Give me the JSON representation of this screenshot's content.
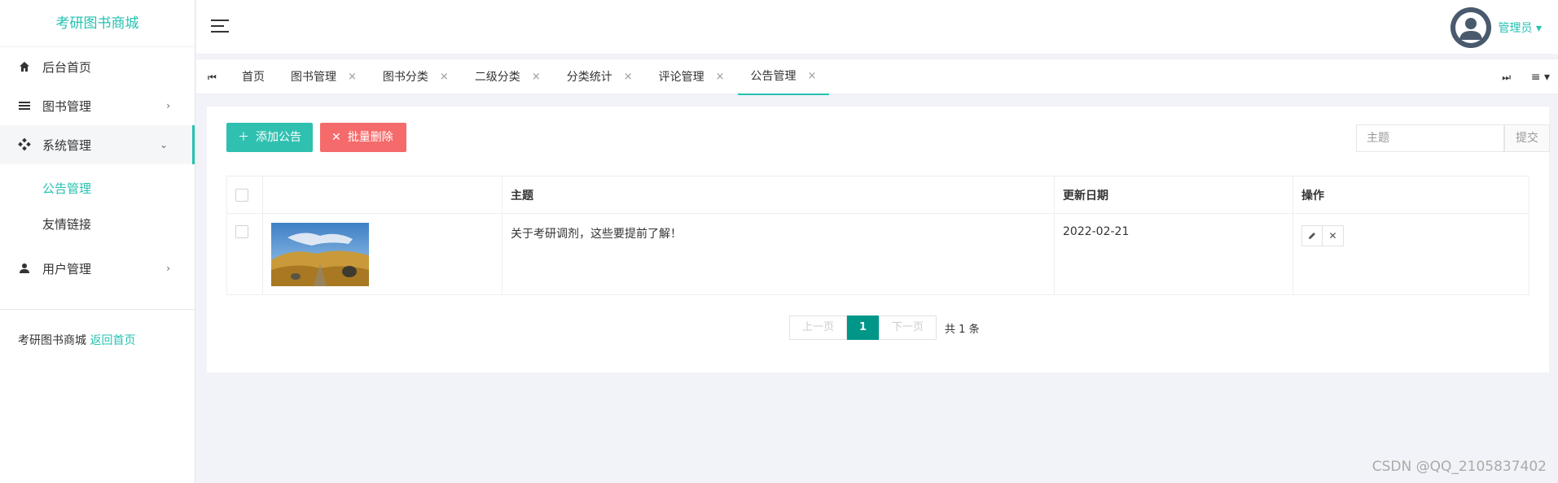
{
  "brand": "考研图书商城",
  "sidebar": {
    "items": [
      {
        "label": "后台首页",
        "icon": "home-icon"
      },
      {
        "label": "图书管理",
        "icon": "menu-lines-icon"
      },
      {
        "label": "系统管理",
        "icon": "grid-diamond-icon"
      },
      {
        "label": "用户管理",
        "icon": "user-icon"
      }
    ],
    "sub_items": [
      {
        "label": "公告管理"
      },
      {
        "label": "友情链接"
      }
    ],
    "footer_text": "考研图书商城",
    "footer_link": "返回首页"
  },
  "header": {
    "user_name": "管理员 ▾"
  },
  "tabs": {
    "nav_left": "⏮",
    "nav_right": "⏭",
    "menu": "≡ ▾",
    "items": [
      {
        "label": "首页"
      },
      {
        "label": "图书管理"
      },
      {
        "label": "图书分类"
      },
      {
        "label": "二级分类"
      },
      {
        "label": "分类统计"
      },
      {
        "label": "评论管理"
      },
      {
        "label": "公告管理"
      }
    ],
    "close": "×"
  },
  "toolbar": {
    "add_label": "添加公告",
    "delete_label": "批量删除",
    "search_placeholder": "主题",
    "submit_label": "提交"
  },
  "table": {
    "headers": [
      "",
      "",
      "主题",
      "更新日期",
      "操作"
    ],
    "rows": [
      {
        "title": "关于考研调剂，这些要提前了解！",
        "date": "2022-02-21"
      }
    ]
  },
  "pagination": {
    "prev": "上一页",
    "current": "1",
    "next": "下一页",
    "total": "共 1 条"
  },
  "watermark": "CSDN @QQ_2105837402",
  "colors": {
    "accent": "#27c1b1",
    "danger": "#f56a6a",
    "page_active": "#009688"
  }
}
